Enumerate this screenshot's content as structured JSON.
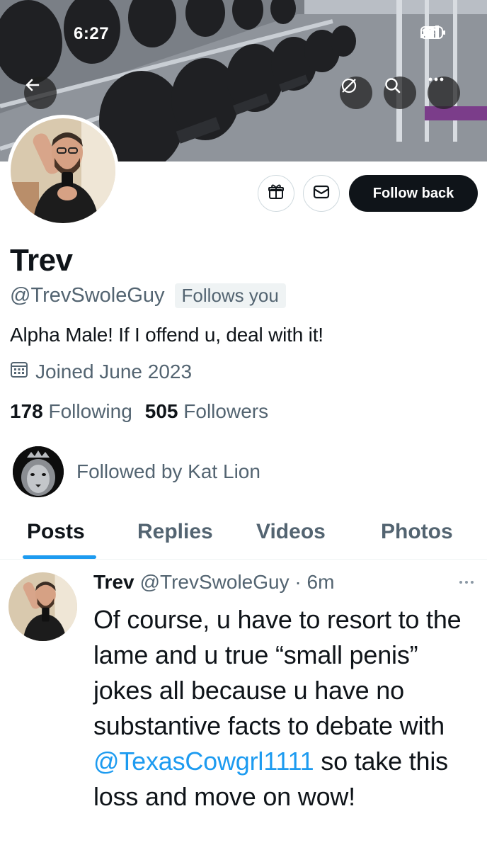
{
  "status_bar": {
    "time": "6:27"
  },
  "profile": {
    "display_name": "Trev",
    "handle": "@TrevSwoleGuy",
    "follows_you": "Follows you",
    "bio": "Alpha Male! If I offend u, deal with it!",
    "joined": "Joined June 2023",
    "following_count": "178",
    "following_label": "Following",
    "followers_count": "505",
    "followers_label": "Followers",
    "followed_by": "Followed by Kat Lion"
  },
  "actions": {
    "follow_back_label": "Follow back"
  },
  "tabs": [
    {
      "label": "Posts",
      "active": true
    },
    {
      "label": "Replies",
      "active": false
    },
    {
      "label": "Videos",
      "active": false
    },
    {
      "label": "Photos",
      "active": false
    }
  ],
  "post": {
    "name": "Trev",
    "handle_time": "@TrevSwoleGuy · 6m",
    "text_before": "Of course, u have to resort to the lame and u true “small penis” jokes all because u have no substantive facts to debate with",
    "mention": "@TexasCowgrl1111",
    "text_after": " so take this loss and move on wow!"
  },
  "colors": {
    "accent": "#1d9bf0",
    "text": "#0f1419",
    "muted": "#536471",
    "button_dark": "#0f1419"
  },
  "icons": [
    "back-arrow-icon",
    "grok-icon",
    "search-icon",
    "more-icon",
    "gift-icon",
    "message-icon",
    "calendar-icon",
    "signal-icon",
    "wifi-icon",
    "battery-icon",
    "post-more-icon"
  ]
}
